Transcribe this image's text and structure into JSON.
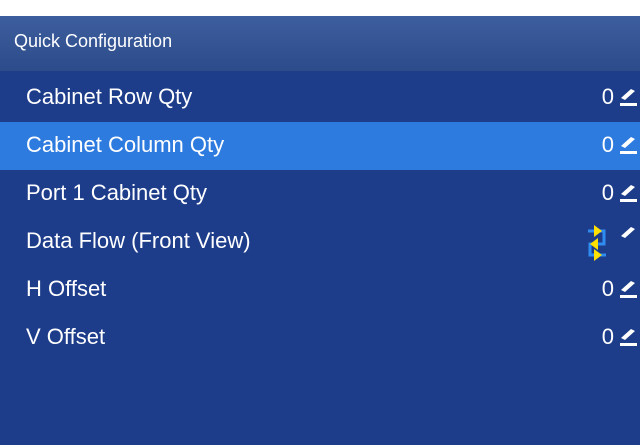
{
  "window": {
    "title": "Quick Configuration"
  },
  "rows": [
    {
      "label": "Cabinet Row Qty",
      "value": "0",
      "icon": "edit-icon"
    },
    {
      "label": "Cabinet Column Qty",
      "value": "0",
      "icon": "edit-icon",
      "selected": true
    },
    {
      "label": "Port 1 Cabinet Qty",
      "value": "0",
      "icon": "edit-icon"
    },
    {
      "label": "Data Flow (Front View)",
      "value": "",
      "icon": "data-flow-icon"
    },
    {
      "label": "H Offset",
      "value": "0",
      "icon": "edit-icon"
    },
    {
      "label": "V Offset",
      "value": "0",
      "icon": "edit-icon"
    }
  ],
  "colors": {
    "panel_background": "#1d3d8b",
    "header_background": "#2c4b8a",
    "selected_row": "#2e7be0",
    "flow_icon_line": "#2e8cf0",
    "flow_icon_arrow": "#ffe000"
  }
}
